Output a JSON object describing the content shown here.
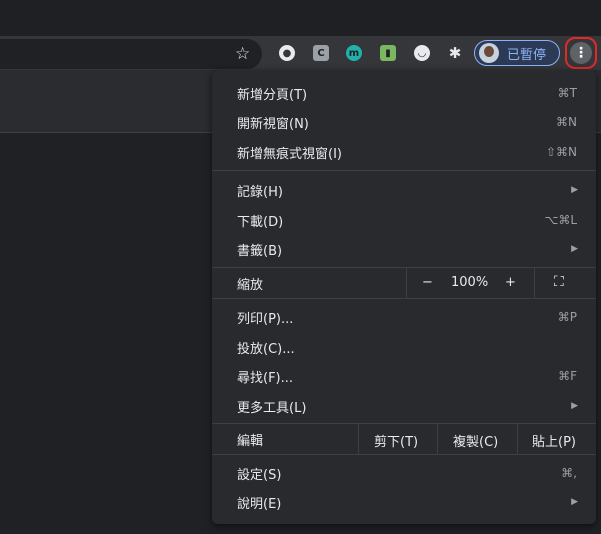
{
  "toolbar": {
    "star_icon": "☆",
    "extensions": [
      {
        "name": "extension-1-icon",
        "glyph": "●"
      },
      {
        "name": "extension-c-icon",
        "glyph": "C"
      },
      {
        "name": "extension-m-icon",
        "glyph": "m"
      },
      {
        "name": "extension-bookmark-icon",
        "glyph": "▮"
      },
      {
        "name": "extension-face-icon",
        "glyph": "◡"
      },
      {
        "name": "puzzle-icon",
        "glyph": "✱"
      }
    ],
    "profile_label": "已暫停",
    "menu_icon": "⋮"
  },
  "menu": {
    "new_tab": {
      "label": "新增分頁(T)",
      "shortcut": "⌘T"
    },
    "new_window": {
      "label": "開新視窗(N)",
      "shortcut": "⌘N"
    },
    "incognito": {
      "label": "新增無痕式視窗(I)",
      "shortcut": "⇧⌘N"
    },
    "history": {
      "label": "記錄(H)",
      "arrow": "▶"
    },
    "downloads": {
      "label": "下載(D)",
      "shortcut": "⌥⌘L"
    },
    "bookmarks": {
      "label": "書籤(B)",
      "arrow": "▶"
    },
    "zoom": {
      "label": "縮放",
      "minus": "−",
      "value": "100%",
      "plus": "+",
      "fullscreen": "⛶"
    },
    "print": {
      "label": "列印(P)...",
      "shortcut": "⌘P"
    },
    "cast": {
      "label": "投放(C)..."
    },
    "find": {
      "label": "尋找(F)...",
      "shortcut": "⌘F"
    },
    "more_tools": {
      "label": "更多工具(L)",
      "arrow": "▶"
    },
    "edit": {
      "label": "編輯",
      "cut": "剪下(T)",
      "copy": "複製(C)",
      "paste": "貼上(P)"
    },
    "settings": {
      "label": "設定(S)",
      "shortcut": "⌘,"
    },
    "help": {
      "label": "說明(E)",
      "arrow": "▶"
    }
  }
}
